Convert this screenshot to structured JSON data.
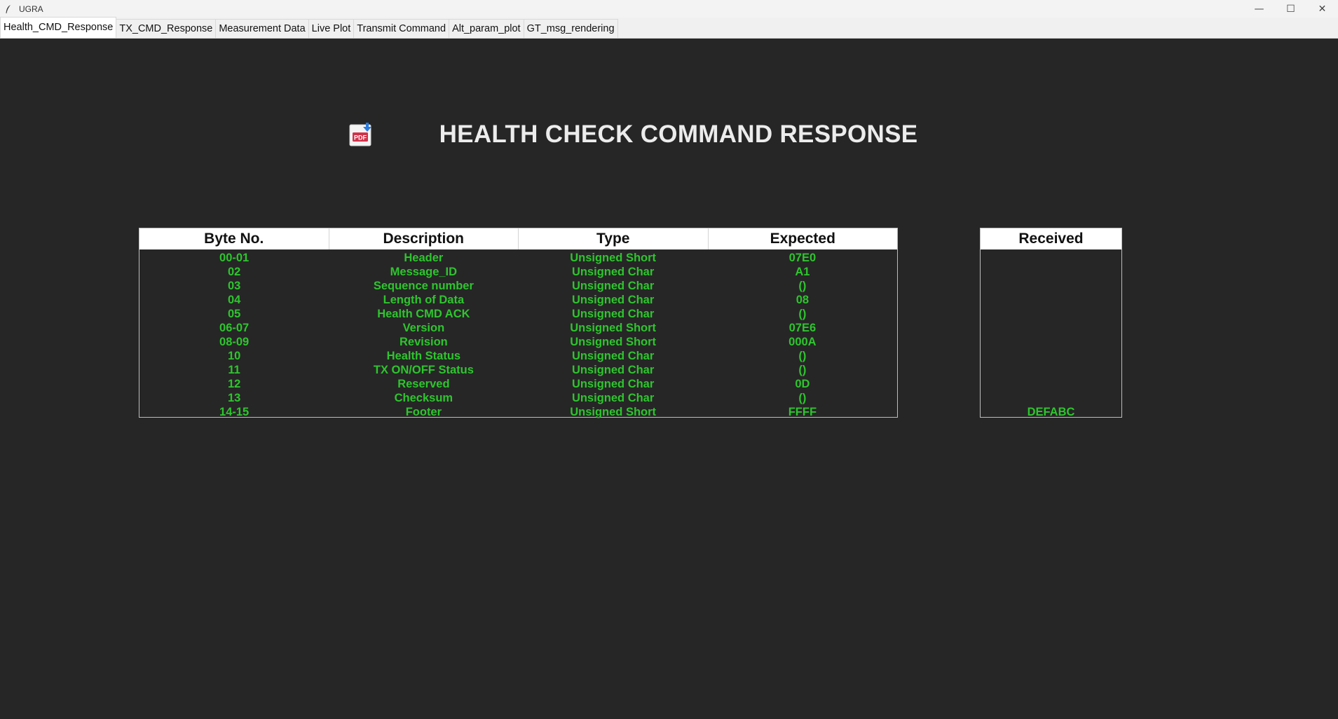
{
  "window": {
    "title": "UGRA",
    "controls": [
      "—",
      "☐",
      "✕"
    ]
  },
  "tabs": [
    {
      "label": "Health_CMD_Response",
      "active": true
    },
    {
      "label": "TX_CMD_Response",
      "active": false
    },
    {
      "label": "Measurement Data",
      "active": false
    },
    {
      "label": "Live Plot",
      "active": false
    },
    {
      "label": "Transmit Command",
      "active": false
    },
    {
      "label": "Alt_param_plot",
      "active": false
    },
    {
      "label": "GT_msg_rendering",
      "active": false
    }
  ],
  "page": {
    "title": "HEALTH CHECK COMMAND RESPONSE",
    "pdf_icon": "pdf-download-icon",
    "pdf_label": "PDF"
  },
  "colors": {
    "background": "#262626",
    "value_text": "#2ec52e",
    "header_bg": "#ffffff",
    "title_text": "#ececec"
  },
  "main_table": {
    "columns": [
      "Byte No.",
      "Description",
      "Type",
      "Expected"
    ],
    "rows": [
      [
        "00-01",
        "Header",
        "Unsigned Short",
        "07E0"
      ],
      [
        "02",
        "Message_ID",
        "Unsigned Char",
        "A1"
      ],
      [
        "03",
        "Sequence number",
        "Unsigned Char",
        "()"
      ],
      [
        "04",
        "Length of Data",
        "Unsigned Char",
        "08"
      ],
      [
        "05",
        "Health CMD ACK",
        "Unsigned Char",
        "()"
      ],
      [
        "06-07",
        "Version",
        "Unsigned Short",
        "07E6"
      ],
      [
        "08-09",
        "Revision",
        "Unsigned Short",
        "000A"
      ],
      [
        "10",
        "Health Status",
        "Unsigned Char",
        "()"
      ],
      [
        "11",
        "TX ON/OFF Status",
        "Unsigned Char",
        "()"
      ],
      [
        "12",
        "Reserved",
        "Unsigned Char",
        "0D"
      ],
      [
        "13",
        "Checksum",
        "Unsigned Char",
        "()"
      ],
      [
        "14-15",
        "Footer",
        "Unsigned Short",
        "FFFF"
      ]
    ]
  },
  "received_table": {
    "header": "Received",
    "values": [
      "",
      "",
      "",
      "",
      "",
      "",
      "",
      "",
      "",
      "",
      "",
      "DEFABC"
    ]
  }
}
